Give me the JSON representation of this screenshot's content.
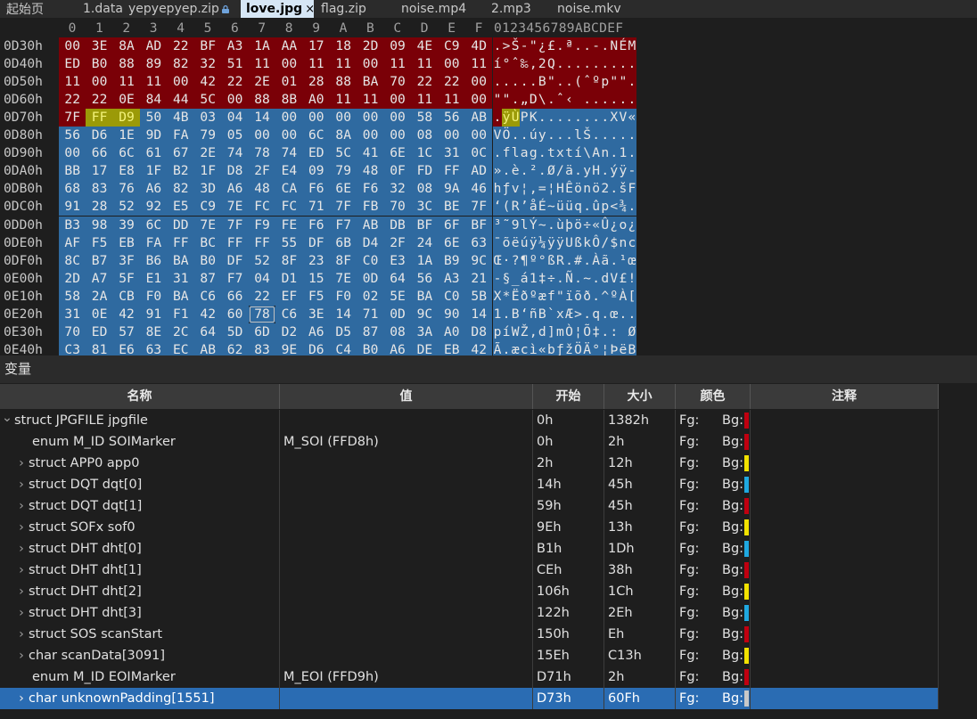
{
  "tabs": [
    {
      "label": "起始页",
      "active": false,
      "locked": false
    },
    {
      "label": "1.data",
      "active": false,
      "locked": false
    },
    {
      "label": "yepyepyep.zip",
      "active": false,
      "locked": true
    },
    {
      "label": "love.jpg",
      "active": true,
      "locked": false,
      "close": "×"
    },
    {
      "label": "flag.zip",
      "active": false,
      "locked": false
    },
    {
      "label": "noise.mp4",
      "active": false,
      "locked": false
    },
    {
      "label": "2.mp3",
      "active": false,
      "locked": false
    },
    {
      "label": "noise.mkv",
      "active": false,
      "locked": false
    }
  ],
  "hex": {
    "column_headers": [
      "0",
      "1",
      "2",
      "3",
      "4",
      "5",
      "6",
      "7",
      "8",
      "9",
      "A",
      "B",
      "C",
      "D",
      "E",
      "F"
    ],
    "ascii_header": "0123456789ABCDEF",
    "rows": [
      {
        "addr": "0D30h",
        "bytes": [
          "00",
          "3E",
          "8A",
          "AD",
          "22",
          "BF",
          "A3",
          "1A",
          "AA",
          "17",
          "18",
          "2D",
          "09",
          "4E",
          "C9",
          "4D"
        ],
        "ascii": ".>Š-\"¿£.ª..-.NÉM"
      },
      {
        "addr": "0D40h",
        "bytes": [
          "ED",
          "B0",
          "88",
          "89",
          "82",
          "32",
          "51",
          "11",
          "00",
          "11",
          "11",
          "00",
          "11",
          "11",
          "00",
          "11"
        ],
        "ascii": "í°ˆ‰‚2Q........."
      },
      {
        "addr": "0D50h",
        "bytes": [
          "11",
          "00",
          "11",
          "11",
          "00",
          "42",
          "22",
          "2E",
          "01",
          "28",
          "88",
          "BA",
          "70",
          "22",
          "22",
          "00"
        ],
        "ascii": ".....B\"..(ˆºp\"\"."
      },
      {
        "addr": "0D60h",
        "bytes": [
          "22",
          "22",
          "0E",
          "84",
          "44",
          "5C",
          "00",
          "88",
          "8B",
          "A0",
          "11",
          "11",
          "00",
          "11",
          "11",
          "00"
        ],
        "ascii": "\"\".„D\\.ˆ‹ ......"
      },
      {
        "addr": "0D70h",
        "bytes": [
          "7F",
          "FF",
          "D9",
          "50",
          "4B",
          "03",
          "04",
          "14",
          "00",
          "00",
          "00",
          "00",
          "00",
          "58",
          "56",
          "AB"
        ],
        "ascii": ".ÿÙPK........XV«"
      },
      {
        "addr": "0D80h",
        "bytes": [
          "56",
          "D6",
          "1E",
          "9D",
          "FA",
          "79",
          "05",
          "00",
          "00",
          "6C",
          "8A",
          "00",
          "00",
          "08",
          "00",
          "00"
        ],
        "ascii": "VÖ..úy...lŠ....."
      },
      {
        "addr": "0D90h",
        "bytes": [
          "00",
          "66",
          "6C",
          "61",
          "67",
          "2E",
          "74",
          "78",
          "74",
          "ED",
          "5C",
          "41",
          "6E",
          "1C",
          "31",
          "0C"
        ],
        "ascii": ".flag.txtí\\An.1."
      },
      {
        "addr": "0DA0h",
        "bytes": [
          "BB",
          "17",
          "E8",
          "1F",
          "B2",
          "1F",
          "D8",
          "2F",
          "E4",
          "09",
          "79",
          "48",
          "0F",
          "FD",
          "FF",
          "AD"
        ],
        "ascii": "».è.².Ø/ä.yH.ýÿ-"
      },
      {
        "addr": "0DB0h",
        "bytes": [
          "68",
          "83",
          "76",
          "A6",
          "82",
          "3D",
          "A6",
          "48",
          "CA",
          "F6",
          "6E",
          "F6",
          "32",
          "08",
          "9A",
          "46"
        ],
        "ascii": "hƒv¦‚=¦HÊönö2.šF"
      },
      {
        "addr": "0DC0h",
        "bytes": [
          "91",
          "28",
          "52",
          "92",
          "E5",
          "C9",
          "7E",
          "FC",
          "FC",
          "71",
          "7F",
          "FB",
          "70",
          "3C",
          "BE",
          "7F"
        ],
        "ascii": "‘(R’åÉ~üüq.ûp<¾."
      },
      {
        "addr": "0DD0h",
        "bytes": [
          "B3",
          "98",
          "39",
          "6C",
          "DD",
          "7E",
          "7F",
          "F9",
          "FE",
          "F6",
          "F7",
          "AB",
          "DB",
          "BF",
          "6F",
          "BF"
        ],
        "ascii": "³˜9lÝ~.ùþö÷«Û¿o¿"
      },
      {
        "addr": "0DE0h",
        "bytes": [
          "AF",
          "F5",
          "EB",
          "FA",
          "FF",
          "BC",
          "FF",
          "FF",
          "55",
          "DF",
          "6B",
          "D4",
          "2F",
          "24",
          "6E",
          "63"
        ],
        "ascii": "¯õëúÿ¼ÿÿUßkÔ/$nc"
      },
      {
        "addr": "0DF0h",
        "bytes": [
          "8C",
          "B7",
          "3F",
          "B6",
          "BA",
          "B0",
          "DF",
          "52",
          "8F",
          "23",
          "8F",
          "C0",
          "E3",
          "1A",
          "B9",
          "9C"
        ],
        "ascii": "Œ·?¶º°ßR.#.Àã.¹œ"
      },
      {
        "addr": "0E00h",
        "bytes": [
          "2D",
          "A7",
          "5F",
          "E1",
          "31",
          "87",
          "F7",
          "04",
          "D1",
          "15",
          "7E",
          "0D",
          "64",
          "56",
          "A3",
          "21"
        ],
        "ascii": "-§_á1‡÷.Ñ.~.dV£!"
      },
      {
        "addr": "0E10h",
        "bytes": [
          "58",
          "2A",
          "CB",
          "F0",
          "BA",
          "C6",
          "66",
          "22",
          "EF",
          "F5",
          "F0",
          "02",
          "5E",
          "BA",
          "C0",
          "5B"
        ],
        "ascii": "X*Ëðºæf\"ïõð.^ºÀ["
      },
      {
        "addr": "0E20h",
        "bytes": [
          "31",
          "0E",
          "42",
          "91",
          "F1",
          "42",
          "60",
          "78",
          "C6",
          "3E",
          "14",
          "71",
          "0D",
          "9C",
          "90",
          "14"
        ],
        "ascii": "1.B‘ñB`xÆ>.q.œ.."
      },
      {
        "addr": "0E30h",
        "bytes": [
          "70",
          "ED",
          "57",
          "8E",
          "2C",
          "64",
          "5D",
          "6D",
          "D2",
          "A6",
          "D5",
          "87",
          "08",
          "3A",
          "A0",
          "D8"
        ],
        "ascii": "píWŽ,d]mÒ¦Õ‡.: Ø"
      },
      {
        "addr": "0E40h",
        "bytes": [
          "C3",
          "81",
          "E6",
          "63",
          "EC",
          "AB",
          "62",
          "83",
          "9E",
          "D6",
          "C4",
          "B0",
          "A6",
          "DE",
          "EB",
          "42"
        ],
        "ascii": "Ã.æcì«bƒžÖÄ°¦ÞëB"
      }
    ]
  },
  "variables": {
    "title": "变量",
    "columns": [
      "名称",
      "值",
      "开始",
      "大小",
      "颜色",
      "注释"
    ],
    "fg_label": "Fg:",
    "bg_label": "Bg:",
    "rows": [
      {
        "indent": 0,
        "expander": "expanded",
        "name": "struct JPGFILE jpgfile",
        "value": "",
        "start": "0h",
        "size": "1382h",
        "swatch": "#c00010",
        "selected": false
      },
      {
        "indent": 1,
        "expander": "none",
        "name": "enum M_ID SOIMarker",
        "value": "M_SOI (FFD8h)",
        "start": "0h",
        "size": "2h",
        "swatch": "#c00010",
        "selected": false
      },
      {
        "indent": 1,
        "expander": "collapsed",
        "name": "struct APP0 app0",
        "value": "",
        "start": "2h",
        "size": "12h",
        "swatch": "#f2e200",
        "selected": false
      },
      {
        "indent": 1,
        "expander": "collapsed",
        "name": "struct DQT dqt[0]",
        "value": "",
        "start": "14h",
        "size": "45h",
        "swatch": "#1fa8e0",
        "selected": false
      },
      {
        "indent": 1,
        "expander": "collapsed",
        "name": "struct DQT dqt[1]",
        "value": "",
        "start": "59h",
        "size": "45h",
        "swatch": "#c00010",
        "selected": false
      },
      {
        "indent": 1,
        "expander": "collapsed",
        "name": "struct SOFx sof0",
        "value": "",
        "start": "9Eh",
        "size": "13h",
        "swatch": "#f2e200",
        "selected": false
      },
      {
        "indent": 1,
        "expander": "collapsed",
        "name": "struct DHT dht[0]",
        "value": "",
        "start": "B1h",
        "size": "1Dh",
        "swatch": "#1fa8e0",
        "selected": false
      },
      {
        "indent": 1,
        "expander": "collapsed",
        "name": "struct DHT dht[1]",
        "value": "",
        "start": "CEh",
        "size": "38h",
        "swatch": "#c00010",
        "selected": false
      },
      {
        "indent": 1,
        "expander": "collapsed",
        "name": "struct DHT dht[2]",
        "value": "",
        "start": "106h",
        "size": "1Ch",
        "swatch": "#f2e200",
        "selected": false
      },
      {
        "indent": 1,
        "expander": "collapsed",
        "name": "struct DHT dht[3]",
        "value": "",
        "start": "122h",
        "size": "2Eh",
        "swatch": "#1fa8e0",
        "selected": false
      },
      {
        "indent": 1,
        "expander": "collapsed",
        "name": "struct SOS scanStart",
        "value": "",
        "start": "150h",
        "size": "Eh",
        "swatch": "#c00010",
        "selected": false
      },
      {
        "indent": 1,
        "expander": "collapsed",
        "name": "char scanData[3091]",
        "value": "",
        "start": "15Eh",
        "size": "C13h",
        "swatch": "#f2e200",
        "selected": false
      },
      {
        "indent": 1,
        "expander": "none",
        "name": "enum M_ID EOIMarker",
        "value": "M_EOI (FFD9h)",
        "start": "D71h",
        "size": "2h",
        "swatch": "#c00010",
        "selected": false
      },
      {
        "indent": 1,
        "expander": "collapsed",
        "name": "char unknownPadding[1551]",
        "value": "",
        "start": "D73h",
        "size": "60Fh",
        "swatch": "#c8c8c8",
        "selected": true
      }
    ]
  }
}
